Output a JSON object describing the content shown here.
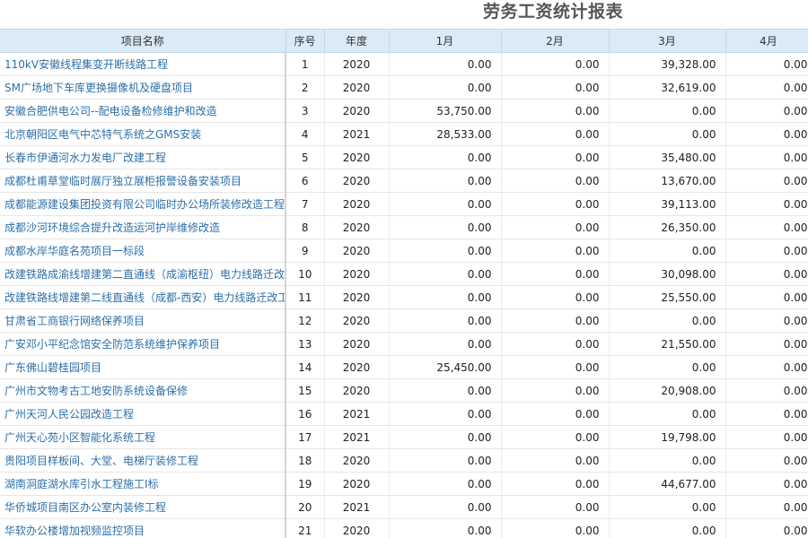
{
  "report": {
    "title": "劳务工资统计报表"
  },
  "table": {
    "columns": [
      "项目名称",
      "序号",
      "年度",
      "1月",
      "2月",
      "3月",
      "4月"
    ],
    "rows": [
      {
        "name": "110kV安徽线程集变开断线路工程",
        "seq": "1",
        "year": "2020",
        "m1": "0.00",
        "m2": "0.00",
        "m3": "39,328.00",
        "m4": "0.00"
      },
      {
        "name": "SM广场地下车库更换摄像机及硬盘项目",
        "seq": "2",
        "year": "2020",
        "m1": "0.00",
        "m2": "0.00",
        "m3": "32,619.00",
        "m4": "0.00"
      },
      {
        "name": "安徽合肥供电公司--配电设备检修维护和改造",
        "seq": "3",
        "year": "2020",
        "m1": "53,750.00",
        "m2": "0.00",
        "m3": "0.00",
        "m4": "0.00"
      },
      {
        "name": "北京朝阳区电气中芯特气系统之GMS安装",
        "seq": "4",
        "year": "2021",
        "m1": "28,533.00",
        "m2": "0.00",
        "m3": "0.00",
        "m4": "0.00"
      },
      {
        "name": "长春市伊通河水力发电厂改建工程",
        "seq": "5",
        "year": "2020",
        "m1": "0.00",
        "m2": "0.00",
        "m3": "35,480.00",
        "m4": "0.00"
      },
      {
        "name": "成都杜甫草堂临时展厅独立展柜报警设备安装项目",
        "seq": "6",
        "year": "2020",
        "m1": "0.00",
        "m2": "0.00",
        "m3": "13,670.00",
        "m4": "0.00"
      },
      {
        "name": "成都能源建设集团投资有限公司临时办公场所装修改造工程EPC",
        "seq": "7",
        "year": "2020",
        "m1": "0.00",
        "m2": "0.00",
        "m3": "39,113.00",
        "m4": "0.00"
      },
      {
        "name": "成都沙河环境综合提升改造运河护岸维修改造",
        "seq": "8",
        "year": "2020",
        "m1": "0.00",
        "m2": "0.00",
        "m3": "26,350.00",
        "m4": "0.00"
      },
      {
        "name": "成都水岸华庭名苑项目一标段",
        "seq": "9",
        "year": "2020",
        "m1": "0.00",
        "m2": "0.00",
        "m3": "0.00",
        "m4": "0.00"
      },
      {
        "name": "改建铁路成渝线增建第二直通线（成渝枢纽）电力线路迁改工程",
        "seq": "10",
        "year": "2020",
        "m1": "0.00",
        "m2": "0.00",
        "m3": "30,098.00",
        "m4": "0.00"
      },
      {
        "name": "改建铁路线增建第二线直通线（成都-西安）电力线路迁改工程",
        "seq": "11",
        "year": "2020",
        "m1": "0.00",
        "m2": "0.00",
        "m3": "25,550.00",
        "m4": "0.00"
      },
      {
        "name": "甘肃省工商银行网络保养项目",
        "seq": "12",
        "year": "2020",
        "m1": "0.00",
        "m2": "0.00",
        "m3": "0.00",
        "m4": "0.00"
      },
      {
        "name": "广安邓小平纪念馆安全防范系统维护保养项目",
        "seq": "13",
        "year": "2020",
        "m1": "0.00",
        "m2": "0.00",
        "m3": "21,550.00",
        "m4": "0.00"
      },
      {
        "name": "广东佛山碧桂园项目",
        "seq": "14",
        "year": "2020",
        "m1": "25,450.00",
        "m2": "0.00",
        "m3": "0.00",
        "m4": "0.00"
      },
      {
        "name": "广州市文物考古工地安防系统设备保修",
        "seq": "15",
        "year": "2020",
        "m1": "0.00",
        "m2": "0.00",
        "m3": "20,908.00",
        "m4": "0.00"
      },
      {
        "name": "广州天河人民公园改造工程",
        "seq": "16",
        "year": "2021",
        "m1": "0.00",
        "m2": "0.00",
        "m3": "0.00",
        "m4": "0.00"
      },
      {
        "name": "广州天心苑小区智能化系统工程",
        "seq": "17",
        "year": "2021",
        "m1": "0.00",
        "m2": "0.00",
        "m3": "19,798.00",
        "m4": "0.00"
      },
      {
        "name": "贵阳项目样板间、大堂、电梯厅装修工程",
        "seq": "18",
        "year": "2020",
        "m1": "0.00",
        "m2": "0.00",
        "m3": "0.00",
        "m4": "0.00"
      },
      {
        "name": "湖南洞庭湖水库引水工程施工I标",
        "seq": "19",
        "year": "2020",
        "m1": "0.00",
        "m2": "0.00",
        "m3": "44,677.00",
        "m4": "0.00"
      },
      {
        "name": "华侨城项目南区办公室内装修工程",
        "seq": "20",
        "year": "2021",
        "m1": "0.00",
        "m2": "0.00",
        "m3": "0.00",
        "m4": "0.00"
      },
      {
        "name": "华软办公楼增加视频监控项目",
        "seq": "21",
        "year": "2020",
        "m1": "0.00",
        "m2": "0.00",
        "m3": "0.00",
        "m4": "0.00"
      }
    ]
  }
}
